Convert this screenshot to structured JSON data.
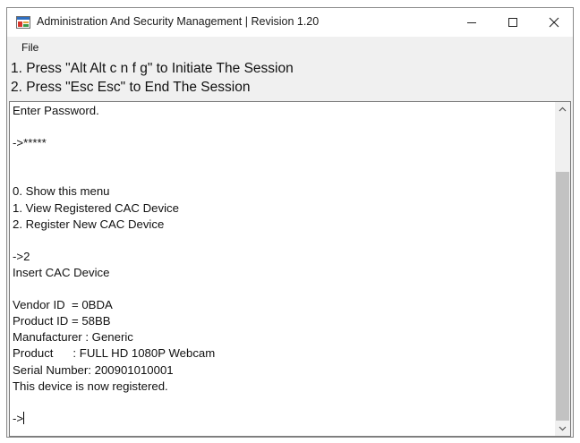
{
  "window": {
    "title": "Administration And Security Management  |  Revision 1.20"
  },
  "menu": {
    "file_label": "File"
  },
  "instructions": {
    "line1": "1. Press \"Alt Alt c n f g\" to Initiate The Session",
    "line2": "2. Press \"Esc Esc\" to End The Session"
  },
  "console": {
    "lines": [
      "Enter Password.",
      "",
      "->*****",
      "",
      "",
      "0. Show this menu",
      "1. View Registered CAC Device",
      "2. Register New CAC Device",
      "",
      "->2",
      "Insert CAC Device",
      "",
      "Vendor ID  = 0BDA",
      "Product ID = 58BB",
      "Manufacturer : Generic",
      "Product      : FULL HD 1080P Webcam",
      "Serial Number: 200901010001",
      "This device is now registered.",
      "",
      "->"
    ],
    "scroll_position": 0.18,
    "visible_fraction": 0.82
  },
  "colors": {
    "titlebar_bg": "#ffffff",
    "window_bg": "#f0f0f0",
    "console_bg": "#ffffff",
    "scroll_thumb": "#c2c2c2",
    "icon_red": "#d8362b",
    "icon_blue": "#2f6fc1"
  },
  "icons": {
    "app": "app-window-icon",
    "minimize": "minimize-icon",
    "maximize": "maximize-icon",
    "close": "close-icon",
    "scroll_up": "chevron-up-icon",
    "scroll_down": "chevron-down-icon"
  }
}
